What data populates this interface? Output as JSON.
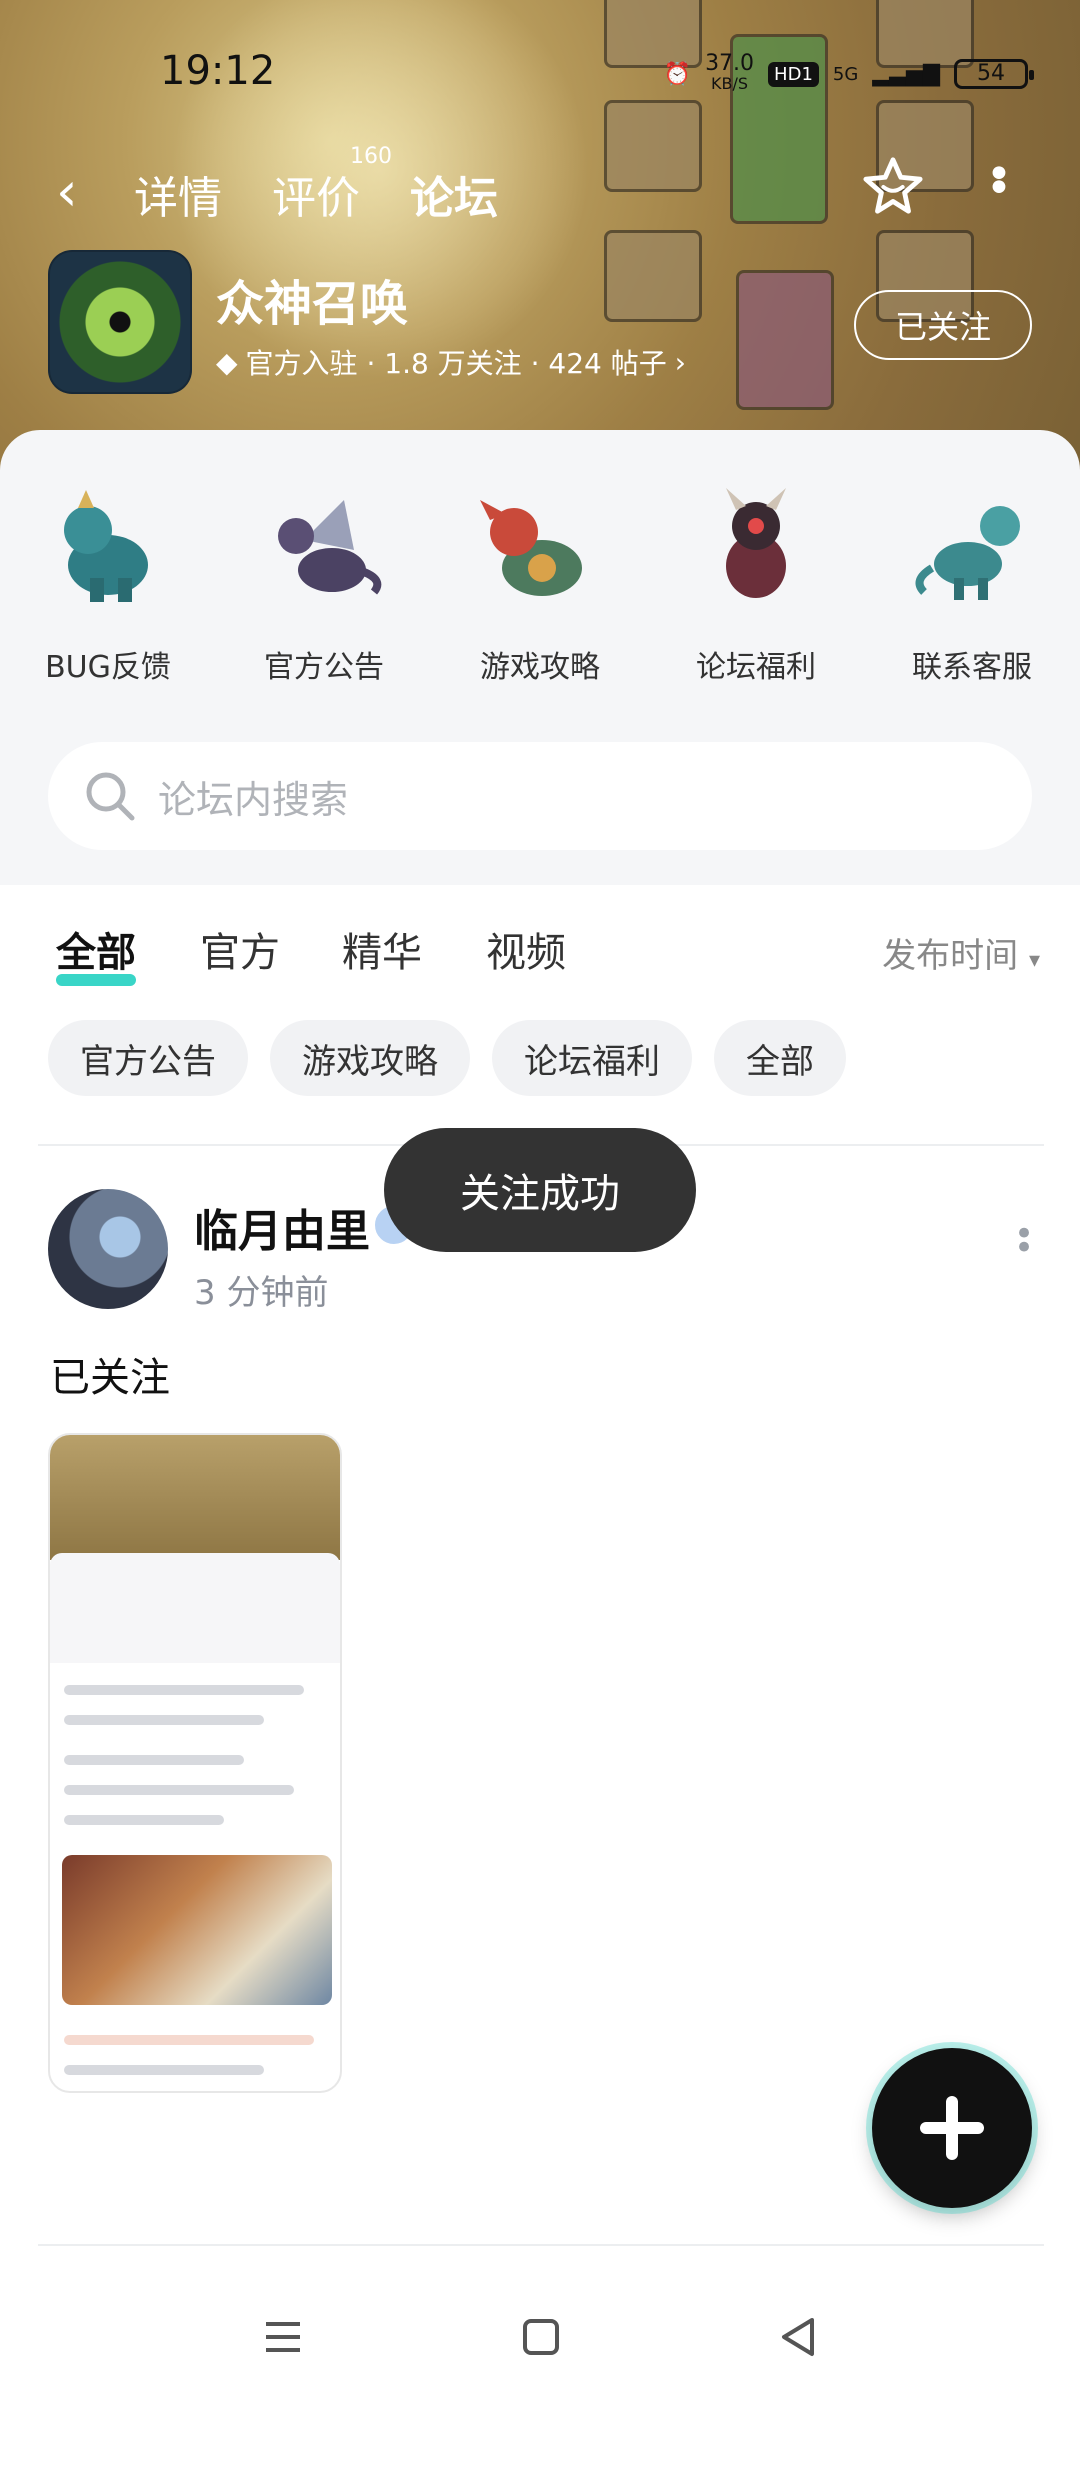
{
  "status_bar": {
    "time": "19:12",
    "net_speed": "37.0",
    "net_unit": "KB/S",
    "hd_label": "HD1",
    "network": "5G",
    "battery": "54"
  },
  "nav": {
    "tabs": [
      "详情",
      "评价",
      "论坛"
    ],
    "review_count": "160",
    "active_tab": "论坛"
  },
  "game": {
    "name": "众神召唤",
    "meta": "官方入驻 · 1.8 万关注 · 424 帖子",
    "follow_label": "已关注"
  },
  "quick_entries": [
    "BUG反馈",
    "官方公告",
    "游戏攻略",
    "论坛福利",
    "联系客服"
  ],
  "search": {
    "placeholder": "论坛内搜索"
  },
  "filter_tabs": [
    "全部",
    "官方",
    "精华",
    "视频"
  ],
  "sort_label": "发布时间",
  "chips": [
    "官方公告",
    "游戏攻略",
    "论坛福利",
    "全部"
  ],
  "post": {
    "author": "临月由里",
    "time": "3 分钟前",
    "content": "已关注"
  },
  "toast": "关注成功",
  "colors": {
    "accent": "#39d5c7",
    "toast_bg": "#333333",
    "fab_bg": "#111111"
  }
}
